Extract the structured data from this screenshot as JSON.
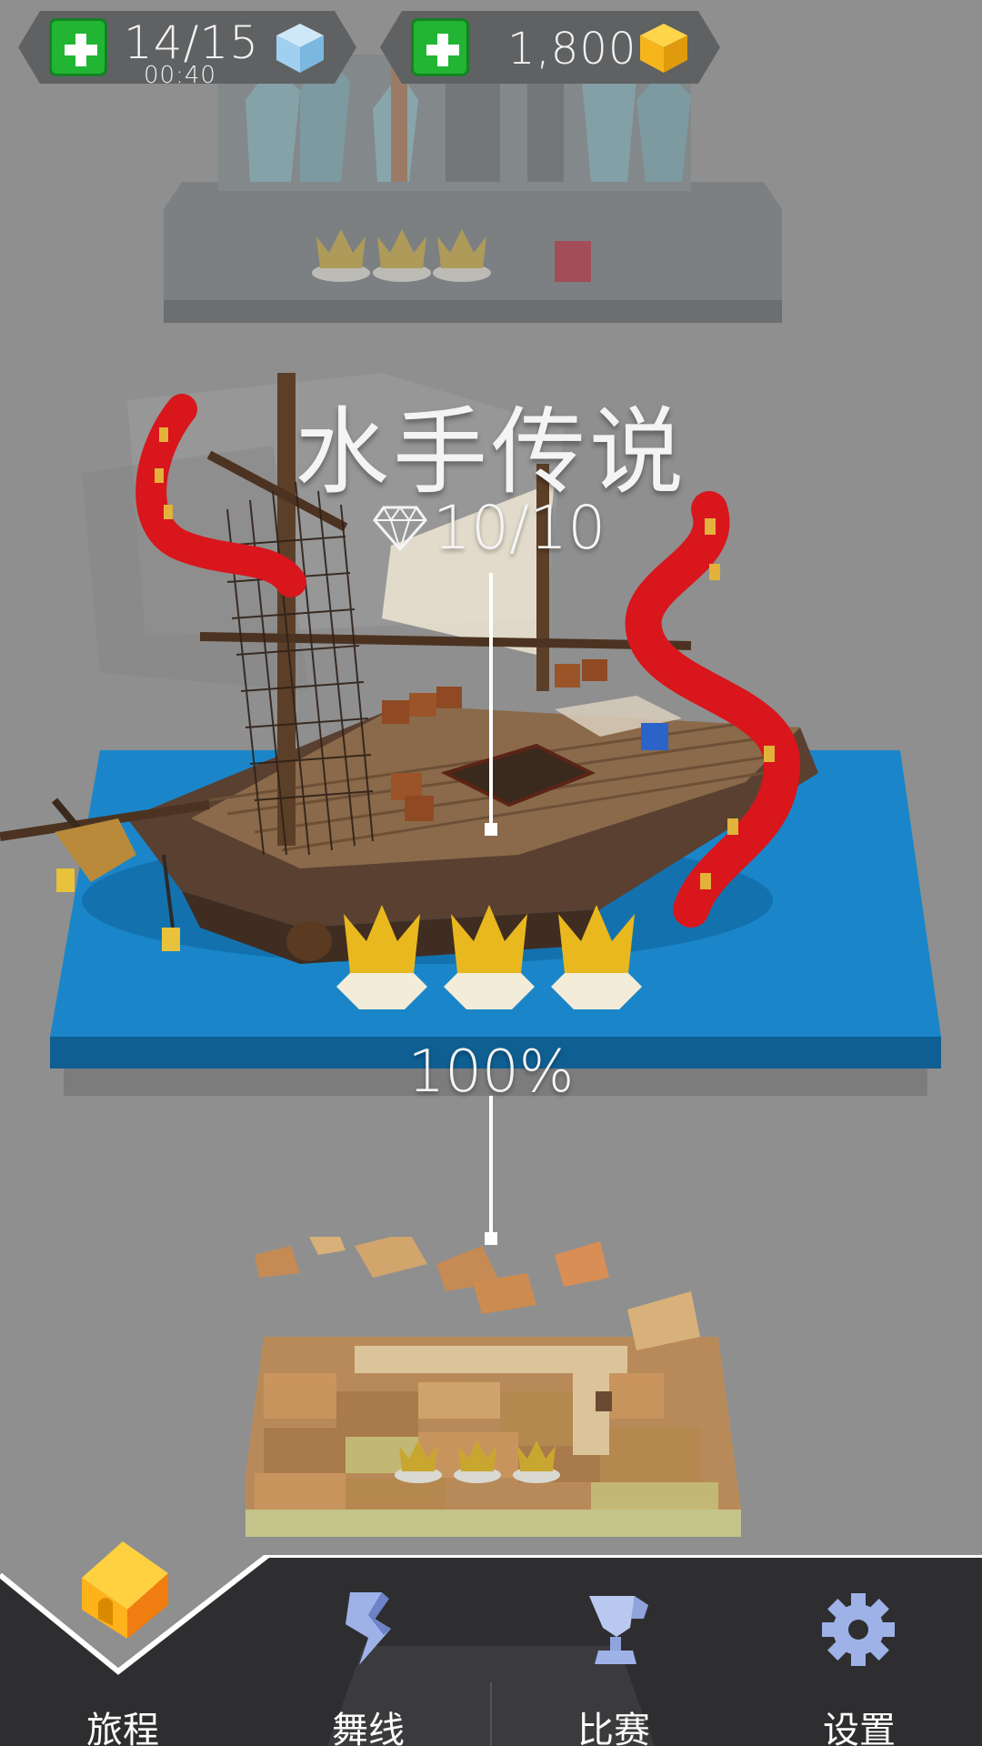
{
  "resources": {
    "energy": {
      "count": "14/15",
      "timer": "00:40",
      "icon": "blue-cube-icon",
      "color": "#9fd0ef"
    },
    "coins": {
      "count": "1,800",
      "icon": "gold-cube-icon",
      "color": "#f5b51b"
    }
  },
  "level": {
    "title": "水手传说",
    "gems": "10/10",
    "gem_icon": "diamond-outline-icon",
    "completion": "100%",
    "crowns_earned": 3,
    "crowns_total": 3
  },
  "nav": {
    "items": [
      {
        "label": "旅程",
        "icon": "house-icon",
        "selected": true
      },
      {
        "label": "舞线",
        "icon": "dance-line-icon",
        "selected": false
      },
      {
        "label": "比赛",
        "icon": "trophy-icon",
        "selected": false
      },
      {
        "label": "设置",
        "icon": "gear-icon",
        "selected": false
      }
    ]
  },
  "colors": {
    "background": "#8f8f8f",
    "accent_green": "#21b533",
    "water": "#1a86c9",
    "tentacle": "#d8161c",
    "crown": "#e9b81f"
  }
}
